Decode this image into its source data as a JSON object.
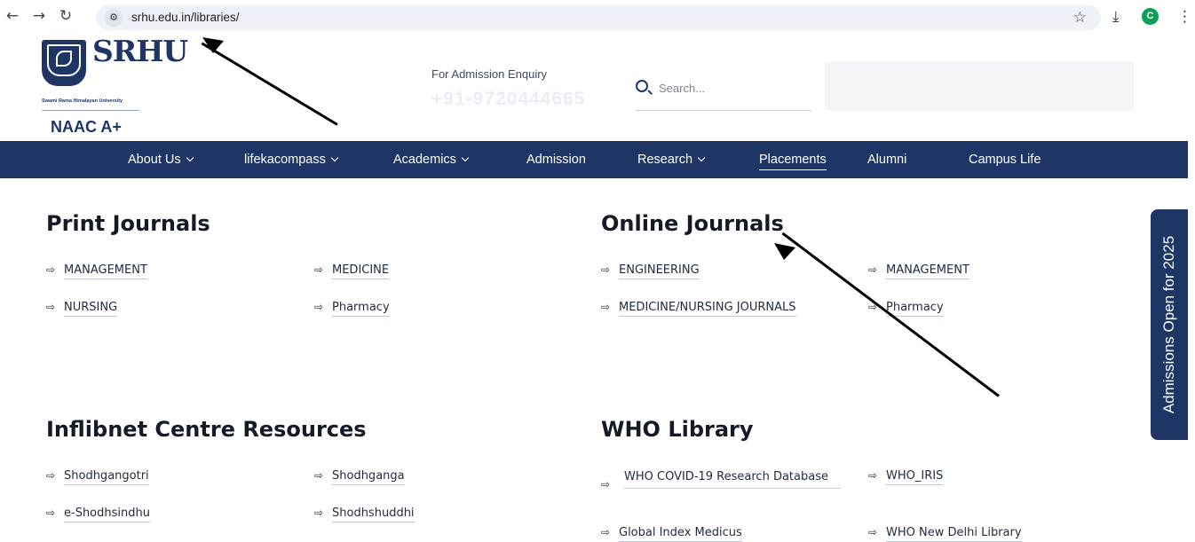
{
  "browser": {
    "url": "srhu.edu.in/libraries/",
    "profile_initial": "C"
  },
  "header": {
    "logo_text": "SRHU",
    "logo_tagline": "Swami Rama Himalayan University",
    "accreditation": "NAAC A+",
    "enquiry_label": "For Admission Enquiry",
    "enquiry_phone": "+91-9720444665",
    "search_placeholder": "Search..."
  },
  "nav": {
    "items": [
      {
        "label": "About Us",
        "dropdown": true
      },
      {
        "label": "lifekacompass",
        "dropdown": true
      },
      {
        "label": "Academics",
        "dropdown": true
      },
      {
        "label": "Admission",
        "dropdown": false
      },
      {
        "label": "Research",
        "dropdown": true
      },
      {
        "label": "Placements",
        "dropdown": false,
        "active": true
      },
      {
        "label": "Alumni",
        "dropdown": false
      },
      {
        "label": "Campus Life",
        "dropdown": false
      }
    ]
  },
  "sections": {
    "print": {
      "title": "Print Journals",
      "links": [
        "MANAGEMENT",
        "MEDICINE",
        "NURSING",
        "Pharmacy"
      ]
    },
    "online": {
      "title": "Online Journals",
      "links": [
        "ENGINEERING",
        "MANAGEMENT",
        "MEDICINE/NURSING JOURNALS",
        "Pharmacy"
      ]
    },
    "inflibnet": {
      "title": "Inflibnet Centre Resources",
      "links": [
        "Shodhgangotri",
        "Shodhganga",
        "e-Shodhsindhu",
        "Shodhshuddhi"
      ]
    },
    "who": {
      "title": "WHO Library",
      "links": [
        "WHO COVID-19 Research Database",
        "WHO_IRIS",
        "Global Index Medicus",
        "WHO New Delhi Library"
      ]
    }
  },
  "side_tab": "Admissions Open for 2025",
  "link_arrow_glyph": "⇨",
  "colors": {
    "brand_navy": "#1f3566",
    "page_bg": "#ffffff"
  }
}
